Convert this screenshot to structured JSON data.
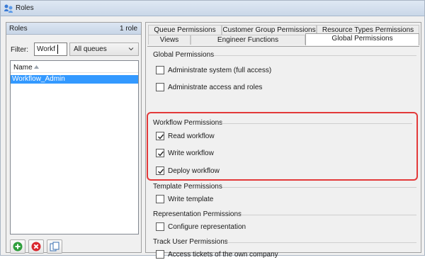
{
  "window": {
    "title": "Roles"
  },
  "left_panel": {
    "header": "Roles",
    "count": "1 role",
    "filter_label": "Filter:",
    "filter_value": "Workf",
    "queue_select": "All queues",
    "list": {
      "column": "Name",
      "rows": [
        "Workflow_Admin"
      ]
    }
  },
  "tabs": {
    "row1": [
      "Queue Permissions",
      "Customer Group Permissions",
      "Resource Types Permissions"
    ],
    "row2": [
      "Views",
      "Engineer Functions",
      "Global Permissions"
    ],
    "active": "Global Permissions"
  },
  "sections": {
    "global": {
      "title": "Global Permissions",
      "items": [
        {
          "label": "Administrate system (full access)",
          "checked": false
        },
        {
          "label": "Administrate access and roles",
          "checked": false
        }
      ]
    },
    "workflow": {
      "title": "Workflow Permissions",
      "items": [
        {
          "label": "Read workflow",
          "checked": true
        },
        {
          "label": "Write workflow",
          "checked": true
        },
        {
          "label": "Deploy workflow",
          "checked": true
        }
      ]
    },
    "template": {
      "title": "Template Permissions",
      "items": [
        {
          "label": "Write template",
          "checked": false
        }
      ]
    },
    "representation": {
      "title": "Representation Permissions",
      "items": [
        {
          "label": "Configure representation",
          "checked": false
        }
      ]
    },
    "track_user": {
      "title": "Track User Permissions",
      "items": [
        {
          "label": "Access tickets of the own company",
          "checked": false
        }
      ]
    }
  },
  "colors": {
    "highlight": "#e33a3a",
    "selection": "#3399ff",
    "add": "#2e9e3b",
    "remove": "#d9272e"
  },
  "icons": [
    "roles-icon",
    "sort-up-icon",
    "chevron-down-icon",
    "add-icon",
    "remove-icon",
    "copy-icon",
    "check-icon"
  ]
}
